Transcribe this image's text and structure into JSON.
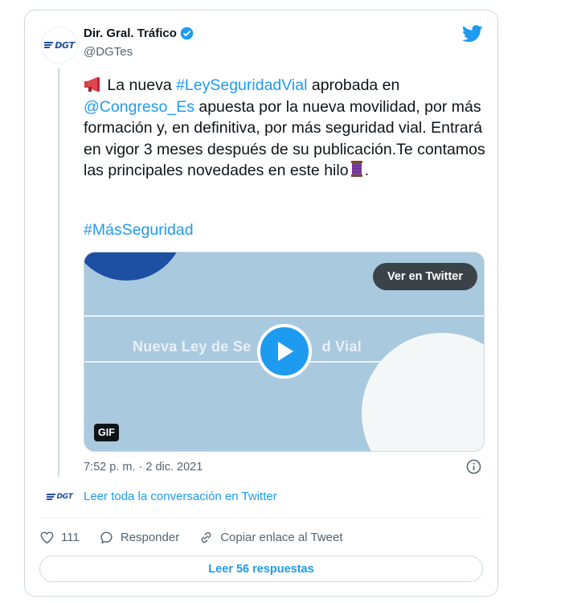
{
  "author": {
    "name": "Dir. Gral. Tráfico",
    "handle": "@DGTes",
    "logo_text": "DGT"
  },
  "tweet": {
    "parts": {
      "p1": "La nueva ",
      "hashtag1": "#LeySeguridadVial",
      "p2": " aprobada en",
      "mention": "@Congreso_Es",
      "p3": " apuesta por la nueva movilidad, por más formación y, en definitiva, por más seguridad vial. Entrará en vigor 3 meses después de su publicación.Te contamos las principales novedades en este hilo",
      "p4": "."
    },
    "hashtag2": "#MásSeguridad"
  },
  "media": {
    "caption_left": "Nueva Ley de Se",
    "caption_right": "d Vial",
    "view_button": "Ver en Twitter",
    "badge": "GIF"
  },
  "timestamp": "7:52 p. m. · 2 dic. 2021",
  "conversation": {
    "link": "Leer toda la conversación en Twitter",
    "logo_text": "DGT"
  },
  "actions": {
    "likes": "111",
    "reply": "Responder",
    "copy": "Copiar enlace al Tweet"
  },
  "read_replies": "Leer 56 respuestas",
  "colors": {
    "link": "#1d9bf0",
    "text": "#0f1419",
    "muted": "#536471"
  }
}
